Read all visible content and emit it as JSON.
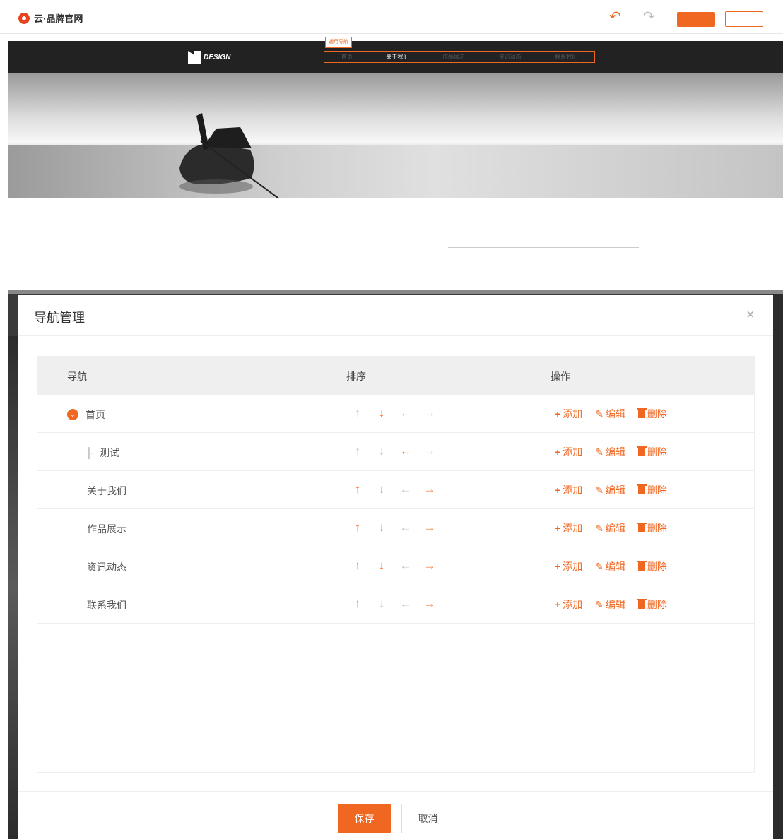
{
  "app": {
    "brand": "云·品牌官网"
  },
  "toolbar": {
    "undo_icon": "undo-icon",
    "redo_icon": "redo-icon",
    "primary_label": "",
    "secondary_label": ""
  },
  "preview": {
    "nav_tag": "通用导航",
    "logo_text": "DESIGN",
    "menu": [
      "首页",
      "关于我们",
      "作品展示",
      "资讯动态",
      "联系我们"
    ],
    "active_menu": "关于我们"
  },
  "modal": {
    "title": "导航管理",
    "close_icon": "close-icon",
    "columns": {
      "nav": "导航",
      "sort": "排序",
      "ops": "操作"
    },
    "rows": [
      {
        "name": "首页",
        "level": 0,
        "expandable": true,
        "sort": {
          "up": false,
          "down": true,
          "left": false,
          "right": false
        }
      },
      {
        "name": "测试",
        "level": 1,
        "expandable": false,
        "sort": {
          "up": false,
          "down": false,
          "left": true,
          "right": false
        }
      },
      {
        "name": "关于我们",
        "level": 0,
        "expandable": false,
        "sort": {
          "up": true,
          "down": true,
          "left": false,
          "right": true
        }
      },
      {
        "name": "作品展示",
        "level": 0,
        "expandable": false,
        "sort": {
          "up": true,
          "down": true,
          "left": false,
          "right": true
        }
      },
      {
        "name": "资讯动态",
        "level": 0,
        "expandable": false,
        "sort": {
          "up": true,
          "down": true,
          "left": false,
          "right": true
        }
      },
      {
        "name": "联系我们",
        "level": 0,
        "expandable": false,
        "sort": {
          "up": true,
          "down": false,
          "left": false,
          "right": true
        }
      }
    ],
    "ops": {
      "add": "添加",
      "edit": "编辑",
      "delete": "删除"
    },
    "footer": {
      "save": "保存",
      "cancel": "取消"
    }
  },
  "colors": {
    "accent": "#f06722",
    "disabled": "#c9c9c9",
    "header_bg": "#efefef",
    "site_nav_bg": "#222222"
  }
}
